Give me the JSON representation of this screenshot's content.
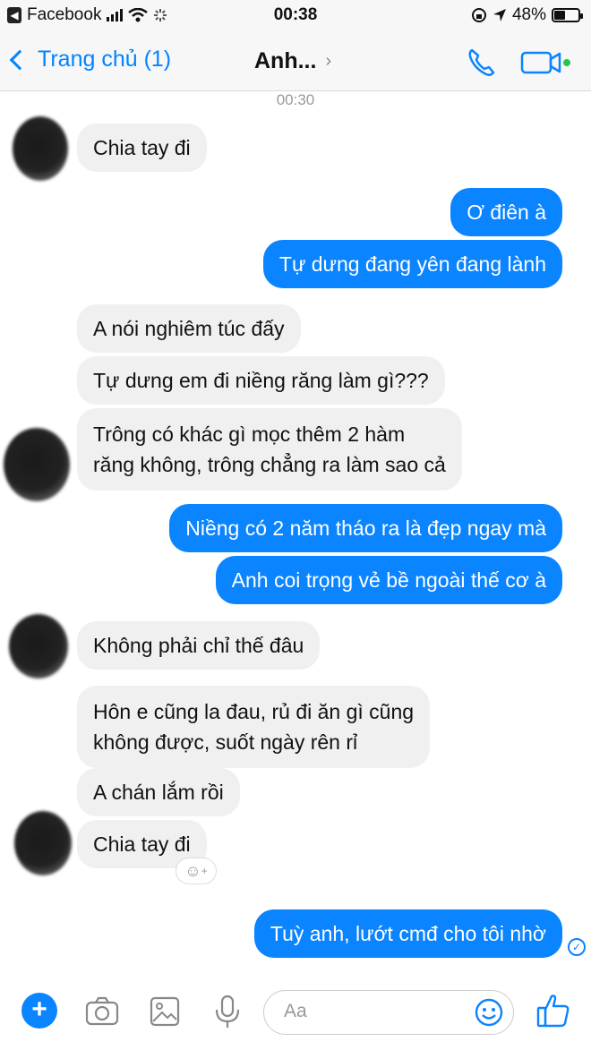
{
  "status_bar": {
    "app_back": "Facebook",
    "time": "00:38",
    "battery": "48%",
    "battery_level": 0.48
  },
  "header": {
    "back_label": "Trang chủ (1)",
    "title": "Anh..."
  },
  "conversation": {
    "timestamp": "00:30",
    "messages": [
      {
        "from": "them",
        "text": "Chia tay đi"
      },
      {
        "from": "me",
        "text": "Ơ điên à"
      },
      {
        "from": "me",
        "text": "Tự dưng đang yên đang lành"
      },
      {
        "from": "them",
        "text": "A nói nghiêm túc đấy"
      },
      {
        "from": "them",
        "text": "Tự dưng em đi niềng răng làm gì???"
      },
      {
        "from": "them",
        "lines": [
          "Trông có khác gì mọc thêm 2 hàm",
          "răng không, trông chẳng ra làm sao cả"
        ]
      },
      {
        "from": "me",
        "text": "Niềng có 2 năm tháo ra là đẹp ngay mà"
      },
      {
        "from": "me",
        "text": "Anh coi trọng vẻ bề ngoài thế cơ à"
      },
      {
        "from": "them",
        "text": "Không phải chỉ thế đâu"
      },
      {
        "from": "them",
        "lines": [
          "Hôn e cũng la đau, rủ đi ăn gì cũng",
          "không được, suốt ngày rên rỉ"
        ]
      },
      {
        "from": "them",
        "text": "A chán lắm rồi"
      },
      {
        "from": "them",
        "text": "Chia tay đi"
      },
      {
        "from": "me",
        "text": "Tuỳ anh, lướt cmđ cho tôi nhờ"
      }
    ]
  },
  "composer": {
    "placeholder": "Aa"
  },
  "colors": {
    "accent": "#0a84ff",
    "incoming_bubble": "#f1f0f0",
    "header_bg": "#f7f7f8"
  },
  "icons": [
    "back-chevron-icon",
    "phone-icon",
    "video-camera-icon",
    "plus-icon",
    "camera-icon",
    "image-icon",
    "microphone-icon",
    "emoji-icon",
    "thumbs-up-icon",
    "add-reaction-icon",
    "seen-check-icon"
  ]
}
